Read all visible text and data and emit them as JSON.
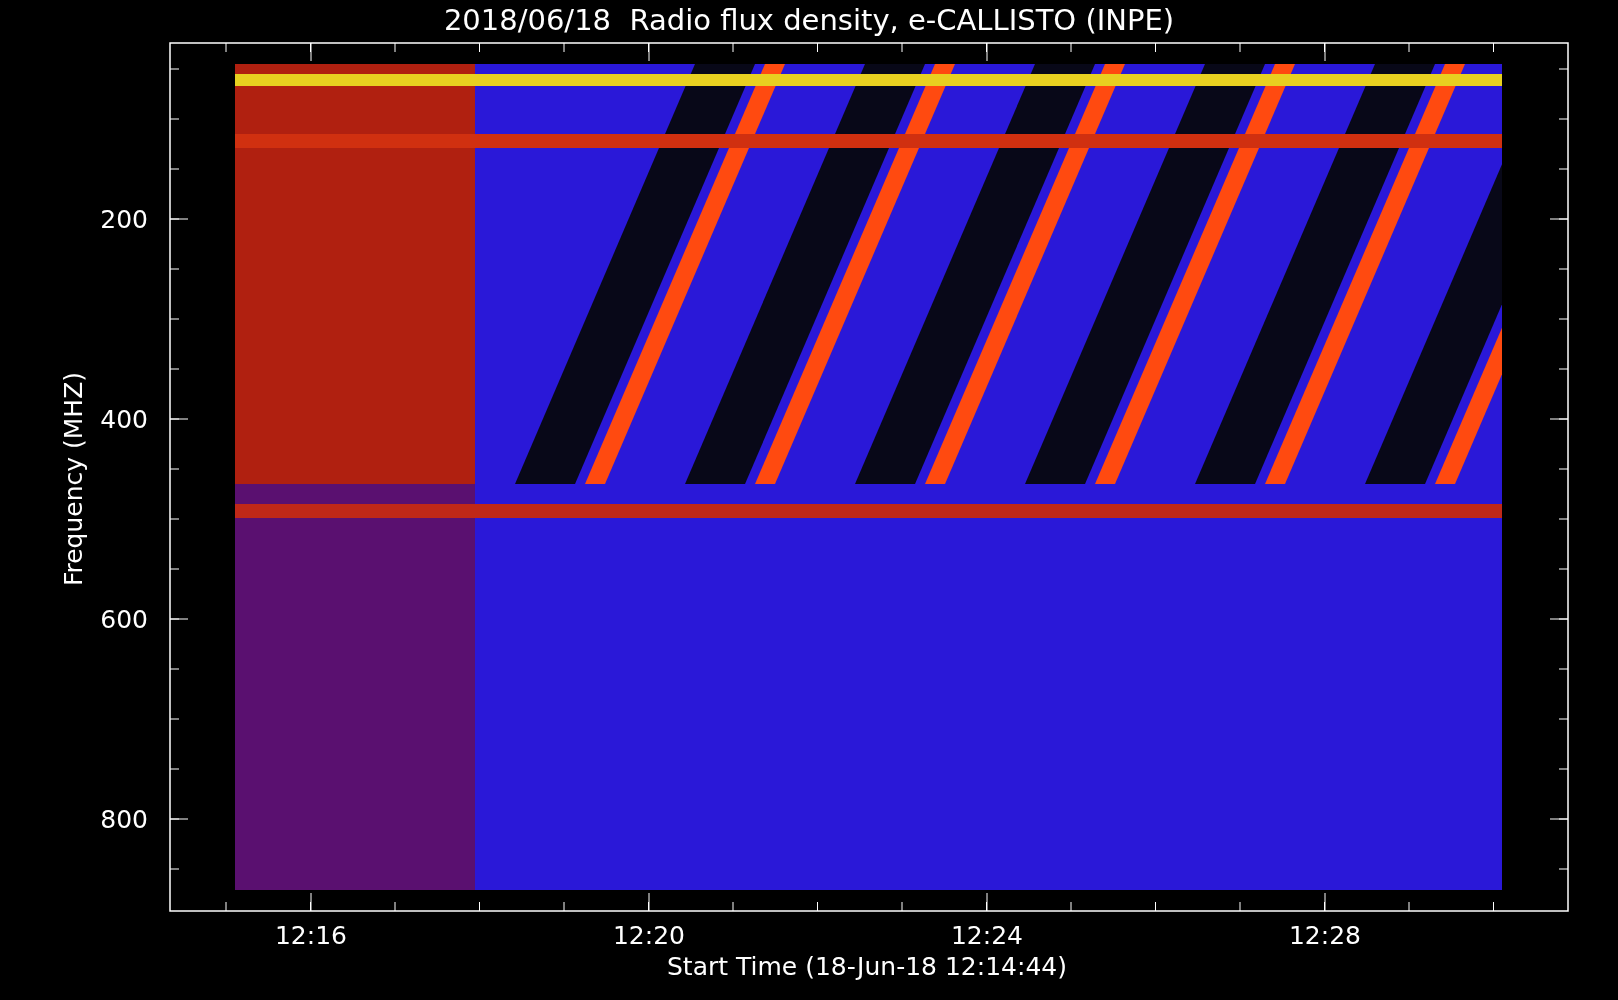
{
  "title": "2018/06/18  Radio flux density, e-CALLISTO (INPE)",
  "axes": {
    "xlabel": "Start Time (18-Jun-18 12:14:44)",
    "ylabel": "Frequency (MHZ)",
    "xticks": [
      "12:16",
      "12:20",
      "12:24",
      "12:28"
    ],
    "yticks": [
      "200",
      "400",
      "600",
      "800"
    ]
  }
}
